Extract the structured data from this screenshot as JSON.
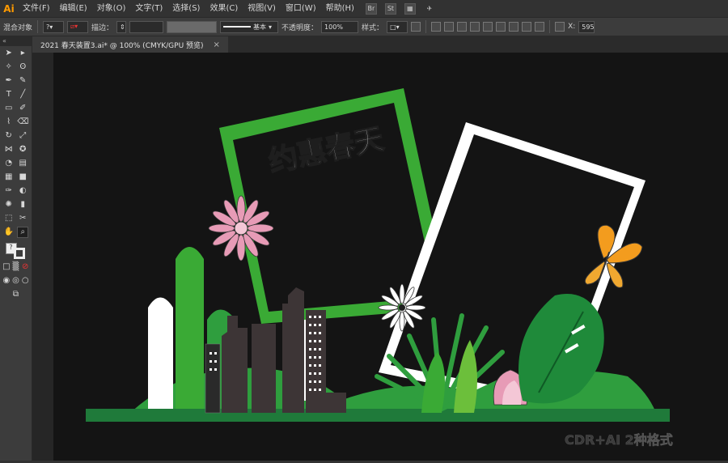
{
  "app": {
    "logo": "Ai"
  },
  "menu": [
    "文件(F)",
    "编辑(E)",
    "对象(O)",
    "文字(T)",
    "选择(S)",
    "效果(C)",
    "视图(V)",
    "窗口(W)",
    "帮助(H)"
  ],
  "menu_icons": {
    "bridge": "Br",
    "stock": "St"
  },
  "control": {
    "selection_label": "混合对象",
    "stroke_label": "描边：",
    "stroke_style": "基本",
    "opacity_label": "不透明度：",
    "opacity_value": "100%",
    "style_label": "样式：",
    "x_label": "X:",
    "x_value": "595"
  },
  "document_tab": {
    "title": "2021 春天装置3.ai* @ 100% (CMYK/GPU 预览)",
    "close": "×"
  },
  "artwork": {
    "headline": "约惠春天",
    "watermark": "CDR+AI 2种格式",
    "colors": {
      "green_frame": "#3aaa35",
      "white_frame": "#ffffff",
      "dark_green": "#1f7a3a",
      "butterfly": "#f39c1e",
      "buildings": "#3d3536"
    }
  }
}
